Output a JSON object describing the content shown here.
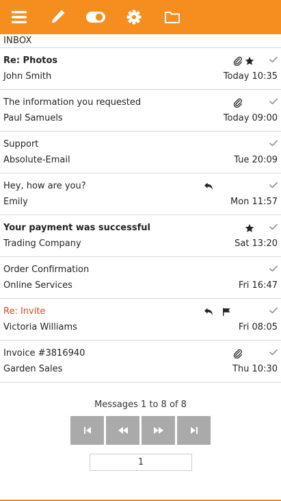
{
  "colors": {
    "accent": "#f68e1f",
    "flagged_text": "#e0451b",
    "pager_button": "#aaaaaa"
  },
  "toolbar": {
    "icons": [
      "menu-icon",
      "edit-icon",
      "toggle-icon",
      "gear-icon",
      "folder-icon"
    ]
  },
  "folder": {
    "title": "INBOX"
  },
  "messages": [
    {
      "subject": "Re: Photos",
      "from": "John Smith",
      "date": "Today 10:35",
      "unread": true,
      "flagged": false,
      "attachment": true,
      "starred": true,
      "replied": false,
      "flag_icon": false
    },
    {
      "subject": "The information you requested",
      "from": "Paul Samuels",
      "date": "Today 09:00",
      "unread": false,
      "flagged": false,
      "attachment": true,
      "starred": false,
      "replied": false,
      "flag_icon": false
    },
    {
      "subject": "Support",
      "from": "Absolute-Email",
      "date": "Tue 20:09",
      "unread": false,
      "flagged": false,
      "attachment": false,
      "starred": false,
      "replied": false,
      "flag_icon": false
    },
    {
      "subject": "Hey, how are you?",
      "from": "Emily",
      "date": "Mon 11:57",
      "unread": false,
      "flagged": false,
      "attachment": false,
      "starred": false,
      "replied": true,
      "flag_icon": false
    },
    {
      "subject": "Your payment was successful",
      "from": "Trading Company",
      "date": "Sat 13:20",
      "unread": true,
      "flagged": false,
      "attachment": false,
      "starred": true,
      "replied": false,
      "flag_icon": false
    },
    {
      "subject": "Order Confirmation",
      "from": "Online Services",
      "date": "Fri 16:47",
      "unread": false,
      "flagged": false,
      "attachment": false,
      "starred": false,
      "replied": false,
      "flag_icon": false
    },
    {
      "subject": "Re: Invite",
      "from": "Victoria Williams",
      "date": "Fri 08:05",
      "unread": false,
      "flagged": true,
      "attachment": false,
      "starred": false,
      "replied": true,
      "flag_icon": true
    },
    {
      "subject": "Invoice #3816940",
      "from": "Garden Sales",
      "date": "Thu 10:30",
      "unread": false,
      "flagged": false,
      "attachment": true,
      "starred": false,
      "replied": false,
      "flag_icon": false
    }
  ],
  "paging": {
    "text": "Messages 1 to 8 of 8",
    "buttons": [
      "first-page-icon",
      "previous-page-icon",
      "next-page-icon",
      "last-page-icon"
    ],
    "page": "1"
  }
}
